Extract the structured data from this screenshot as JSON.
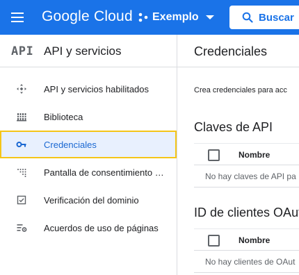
{
  "header": {
    "brand": "Google Cloud",
    "project": "Exemplo",
    "search_label": "Buscar"
  },
  "sidebar": {
    "logo": "API",
    "title": "API y servicios",
    "items": [
      {
        "label": "API y servicios habilitados",
        "icon": "hub-icon"
      },
      {
        "label": "Biblioteca",
        "icon": "library-icon"
      },
      {
        "label": "Credenciales",
        "icon": "key-icon",
        "active": true
      },
      {
        "label": "Pantalla de consentimiento …",
        "icon": "consent-icon"
      },
      {
        "label": "Verificación del dominio",
        "icon": "check-box-icon"
      },
      {
        "label": "Acuerdos de uso de páginas",
        "icon": "settings-list-icon"
      }
    ]
  },
  "main": {
    "title": "Credenciales",
    "intro": "Crea credenciales para acc",
    "api_keys": {
      "title": "Claves de API",
      "col_name": "Nombre",
      "empty": "No hay claves de API pa"
    },
    "oauth": {
      "title": "ID de clientes OAut",
      "col_name": "Nombre",
      "empty": "No hay clientes de OAut"
    }
  },
  "colors": {
    "brand_blue": "#1a73e8",
    "active_bg": "#e8f0fe",
    "highlight": "#f5c518"
  }
}
